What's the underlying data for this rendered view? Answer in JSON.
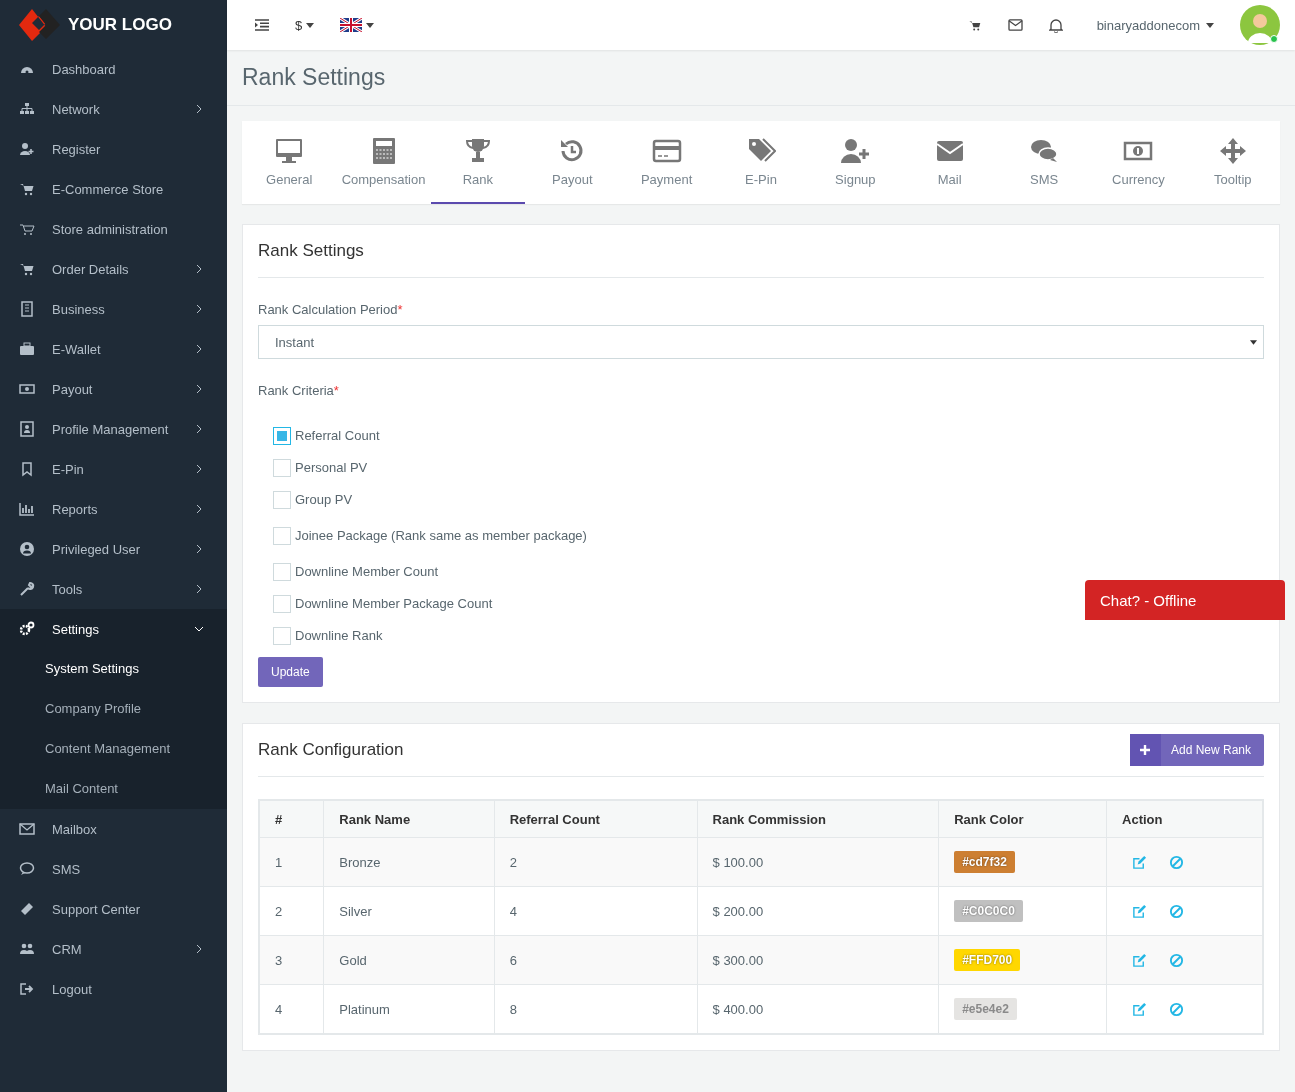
{
  "sidebar": {
    "logo": "YOUR LOGO",
    "items": [
      {
        "label": "Dashboard",
        "submenu": false,
        "selected": false
      },
      {
        "label": "Network",
        "submenu": true,
        "expanded": false,
        "selected": false
      },
      {
        "label": "Register",
        "submenu": false,
        "selected": false
      },
      {
        "label": "E-Commerce Store",
        "submenu": false,
        "selected": false
      },
      {
        "label": "Store administration",
        "submenu": false,
        "selected": false
      },
      {
        "label": "Order Details",
        "submenu": true,
        "expanded": false,
        "selected": false
      },
      {
        "label": "Business",
        "submenu": true,
        "expanded": false,
        "selected": false
      },
      {
        "label": "E-Wallet",
        "submenu": true,
        "expanded": false,
        "selected": false
      },
      {
        "label": "Payout",
        "submenu": true,
        "expanded": false,
        "selected": false
      },
      {
        "label": "Profile Management",
        "submenu": true,
        "expanded": false,
        "selected": false
      },
      {
        "label": "E-Pin",
        "submenu": true,
        "expanded": false,
        "selected": false
      },
      {
        "label": "Reports",
        "submenu": true,
        "expanded": false,
        "selected": false
      },
      {
        "label": "Privileged User",
        "submenu": true,
        "expanded": false,
        "selected": false
      },
      {
        "label": "Tools",
        "submenu": true,
        "expanded": false,
        "selected": false
      },
      {
        "label": "Settings",
        "submenu": true,
        "expanded": true,
        "selected": true,
        "children": [
          {
            "label": "System Settings",
            "selected": true
          },
          {
            "label": "Company Profile",
            "selected": false
          },
          {
            "label": "Content Management",
            "selected": false
          },
          {
            "label": "Mail Content",
            "selected": false
          }
        ]
      },
      {
        "label": "Mailbox",
        "submenu": false,
        "selected": false
      },
      {
        "label": "SMS",
        "submenu": false,
        "selected": false
      },
      {
        "label": "Support Center",
        "submenu": false,
        "selected": false
      },
      {
        "label": "CRM",
        "submenu": true,
        "expanded": false,
        "selected": false
      },
      {
        "label": "Logout",
        "submenu": false,
        "selected": false
      }
    ]
  },
  "topbar": {
    "currency": "$",
    "username": "binaryaddonecom"
  },
  "page_title": "Rank Settings",
  "tabs": [
    {
      "label": "General",
      "selected": false
    },
    {
      "label": "Compensation",
      "selected": false
    },
    {
      "label": "Rank",
      "selected": true
    },
    {
      "label": "Payout",
      "selected": false
    },
    {
      "label": "Payment",
      "selected": false
    },
    {
      "label": "E-Pin",
      "selected": false
    },
    {
      "label": "Signup",
      "selected": false
    },
    {
      "label": "Mail",
      "selected": false
    },
    {
      "label": "SMS",
      "selected": false
    },
    {
      "label": "Currency",
      "selected": false
    },
    {
      "label": "Tooltip",
      "selected": false
    }
  ],
  "rank_settings": {
    "title": "Rank Settings",
    "period_label": "Rank Calculation Period",
    "required_mark": "*",
    "period_value": "Instant",
    "criteria_label": "Rank Criteria",
    "criteria_required_mark": "*",
    "criteria": [
      {
        "label": "Referral Count",
        "checked": true
      },
      {
        "label": "Personal PV",
        "checked": false
      },
      {
        "label": "Group PV",
        "checked": false
      },
      {
        "label": "Joinee Package (Rank same as member package)",
        "checked": false
      },
      {
        "label": "Downline Member Count",
        "checked": false
      },
      {
        "label": "Downline Member Package Count",
        "checked": false
      },
      {
        "label": "Downline Rank",
        "checked": false
      }
    ],
    "update_button": "Update"
  },
  "rank_configuration": {
    "title": "Rank Configuration",
    "add_button": "Add New Rank",
    "columns": [
      "#",
      "Rank Name",
      "Referral Count",
      "Rank Commission",
      "Rank Color",
      "Action"
    ],
    "rows": [
      {
        "index": "1",
        "name": "Bronze",
        "referral_count": "2",
        "commission": "$ 100.00",
        "color_label": "#cd7f32",
        "color": "#cd7f32"
      },
      {
        "index": "2",
        "name": "Silver",
        "referral_count": "4",
        "commission": "$ 200.00",
        "color_label": "#C0C0C0",
        "color": "#c0c0c0"
      },
      {
        "index": "3",
        "name": "Gold",
        "referral_count": "6",
        "commission": "$ 300.00",
        "color_label": "#FFD700",
        "color": "#ffd700"
      },
      {
        "index": "4",
        "name": "Platinum",
        "referral_count": "8",
        "commission": "$ 400.00",
        "color_label": "#e5e4e2",
        "color": "#e5e4e2"
      }
    ]
  },
  "chat": {
    "label": "Chat? - Offline"
  }
}
